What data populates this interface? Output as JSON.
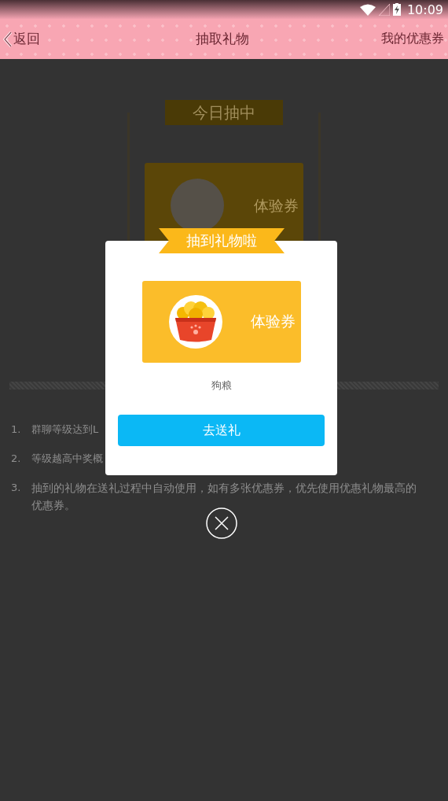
{
  "status_bar": {
    "time": "10:09"
  },
  "header": {
    "back": "返回",
    "title": "抽取礼物",
    "right_link": "我的优惠券"
  },
  "today_banner": "今日抽中",
  "background_ticket": {
    "label": "体验券"
  },
  "rules": [
    {
      "number": "1.",
      "text": "群聊等级达到L"
    },
    {
      "number": "2.",
      "text": "等级越高中奖概"
    },
    {
      "number": "3.",
      "text": "抽到的礼物在送礼过程中自动使用，如有多张优惠券，优先使用优惠礼物最高的优惠券。"
    }
  ],
  "dialog": {
    "ribbon": "抽到礼物啦",
    "ticket_label": "体验券",
    "gift_name": "狗粮",
    "button": "去送礼"
  }
}
